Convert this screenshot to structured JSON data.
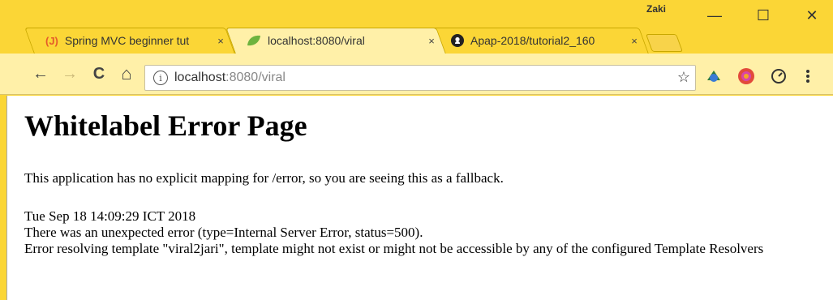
{
  "profile": {
    "name": "Zaki"
  },
  "window_controls": {
    "minimize": "—",
    "maximize": "☐",
    "close": "✕"
  },
  "tabs": [
    {
      "label": "Spring MVC beginner tut",
      "favicon": "J",
      "active": false,
      "close": "×"
    },
    {
      "label": "localhost:8080/viral",
      "favicon": "leaf",
      "active": true,
      "close": "×"
    },
    {
      "label": "Apap-2018/tutorial2_160",
      "favicon": "github",
      "active": false,
      "close": "×"
    }
  ],
  "toolbar": {
    "back": "←",
    "forward": "→",
    "reload": "C",
    "home": "⌂",
    "star": "☆"
  },
  "omnibox": {
    "host": "localhost",
    "rest": ":8080/viral"
  },
  "page": {
    "title": "Whitelabel Error Page",
    "paragraph": "This application has no explicit mapping for /error, so you are seeing this as a fallback.",
    "timestamp": "Tue Sep 18 14:09:29 ICT 2018",
    "error_line": "There was an unexpected error (type=Internal Server Error, status=500).",
    "detail": "Error resolving template \"viral2jari\", template might not exist or might not be accessible by any of the configured Template Resolvers"
  },
  "colors": {
    "chrome": "#fbd636",
    "active_tab": "#fff0a8",
    "close_hover": "#e81123"
  }
}
